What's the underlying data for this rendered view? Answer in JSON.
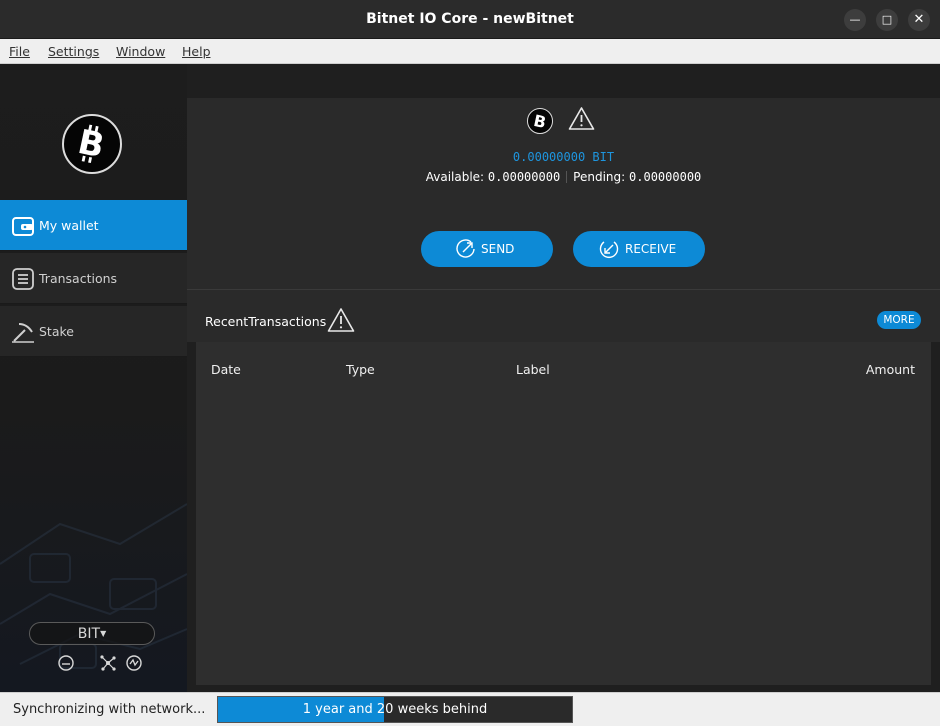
{
  "window": {
    "title": "Bitnet IO Core - newBitnet",
    "minimize_icon": "minimize-icon",
    "maximize_icon": "maximize-icon",
    "close_icon": "close-icon"
  },
  "menubar": {
    "items": [
      {
        "label": "File"
      },
      {
        "label": "Settings"
      },
      {
        "label": "Window"
      },
      {
        "label": "Help"
      }
    ]
  },
  "sidebar": {
    "logo_icon": "bitcoin-logo-icon",
    "items": [
      {
        "label": "My wallet",
        "icon": "wallet-icon",
        "active": true
      },
      {
        "label": "Transactions",
        "icon": "list-icon",
        "active": false
      },
      {
        "label": "Stake",
        "icon": "pickaxe-icon",
        "active": false
      }
    ],
    "unit": "BIT",
    "status_icons": [
      "no-staking-icon",
      "network-icon",
      "sync-icon"
    ]
  },
  "overview": {
    "balance": "0.00000000 BIT",
    "available_label": "Available:",
    "available_value": "0.00000000",
    "pending_label": "Pending:",
    "pending_value": "0.00000000",
    "send_label": "SEND",
    "receive_label": "RECEIVE"
  },
  "recent": {
    "title": "RecentTransactions",
    "more_label": "MORE",
    "columns": [
      "Date",
      "Type",
      "Label",
      "Amount"
    ],
    "rows": []
  },
  "statusbar": {
    "sync_text": "Synchronizing with network...",
    "progress_text": "1 year and 20 weeks behind",
    "progress_fraction": 0.47
  },
  "colors": {
    "accent": "#0d8ad6",
    "balance": "#1e95de"
  }
}
